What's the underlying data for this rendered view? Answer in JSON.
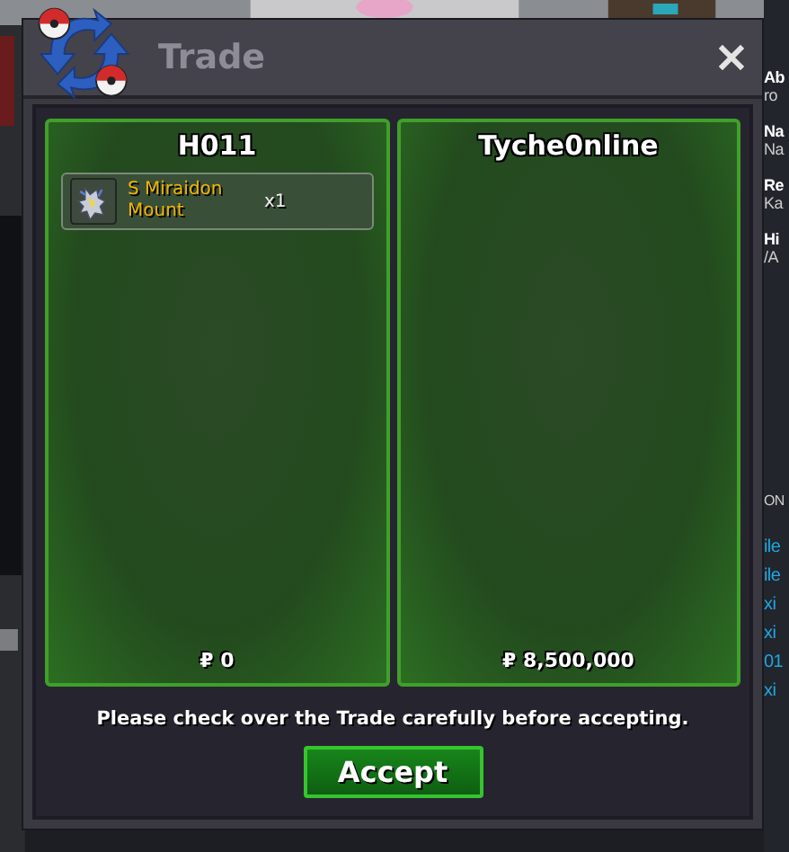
{
  "window": {
    "title": "Trade"
  },
  "offers": [
    {
      "trader": "H011",
      "items": [
        {
          "name": "S Miraidon Mount",
          "quantity": "x1"
        }
      ],
      "money": "₽ 0"
    },
    {
      "trader": "Tyche0nline",
      "money": "₽ 8,500,000"
    }
  ],
  "notice": "Please check over the Trade carefully before accepting.",
  "accept_button": "Accept",
  "side_panel": {
    "fields": [
      {
        "label": "Ab",
        "value": "ro"
      },
      {
        "label": "Na",
        "value": "Na"
      },
      {
        "label": "Re",
        "value": "Ka"
      },
      {
        "label": "Hi",
        "value": "/A"
      }
    ],
    "header": "ON",
    "links": [
      "ile",
      "ile",
      "xi",
      "xi",
      "01",
      "xi"
    ]
  }
}
